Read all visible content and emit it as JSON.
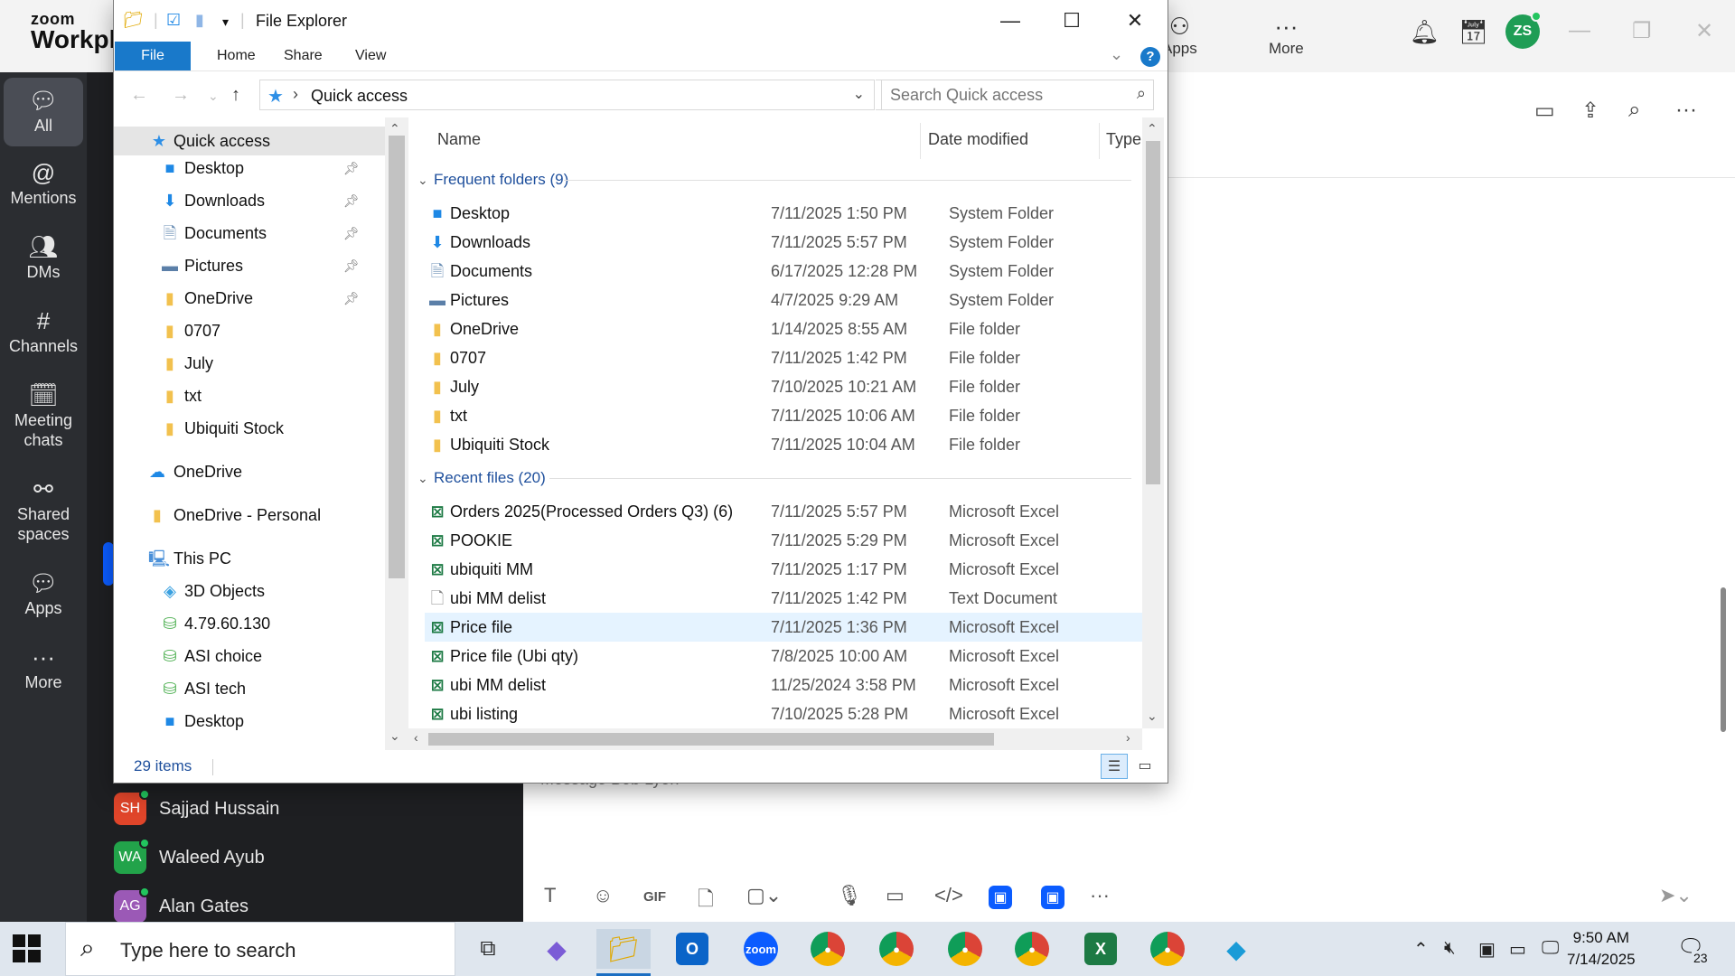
{
  "zoom": {
    "logo_line1": "zoom",
    "logo_line2": "Workplac",
    "top": {
      "apps_label": "Apps",
      "more_label": "More",
      "avatar": "ZS"
    },
    "nav": [
      {
        "label": "All",
        "icon": "chat-bubble-icon"
      },
      {
        "label": "Mentions",
        "icon": "at-icon"
      },
      {
        "label": "DMs",
        "icon": "people-icon"
      },
      {
        "label": "Channels",
        "icon": "hash-icon"
      },
      {
        "label_line1": "Meeting",
        "label_line2": "chats",
        "icon": "calendar-icon"
      },
      {
        "label_line1": "Shared",
        "label_line2": "spaces",
        "icon": "share-nodes-icon"
      },
      {
        "label": "Apps",
        "icon": "apps-icon"
      },
      {
        "label": "More",
        "icon": "more-dots-icon"
      }
    ],
    "chats": [
      {
        "initials": "SH",
        "name": "Sajjad Hussain",
        "color": "#e0452a"
      },
      {
        "initials": "WA",
        "name": "Waleed Ayub",
        "color": "#22a34a"
      },
      {
        "initials": "AG",
        "name": "Alan Gates",
        "color": "#9b59b6"
      }
    ],
    "message_placeholder": "Message Bob Lyon"
  },
  "explorer": {
    "title": "File Explorer",
    "ribbon_tabs": [
      "File",
      "Home",
      "Share",
      "View"
    ],
    "address_path": "Quick access",
    "search_placeholder": "Search Quick access",
    "nav_items": [
      {
        "label": "Quick access",
        "icon": "star-icon",
        "selected": true
      },
      {
        "label": "Desktop",
        "icon": "desktop-icon",
        "pinned": true
      },
      {
        "label": "Downloads",
        "icon": "download-icon",
        "pinned": true
      },
      {
        "label": "Documents",
        "icon": "documents-icon",
        "pinned": true
      },
      {
        "label": "Pictures",
        "icon": "pictures-icon",
        "pinned": true
      },
      {
        "label": "OneDrive",
        "icon": "folder-onedrive-icon",
        "pinned": true
      },
      {
        "label": "0707",
        "icon": "folder-icon"
      },
      {
        "label": "July",
        "icon": "folder-icon"
      },
      {
        "label": "txt",
        "icon": "folder-icon"
      },
      {
        "label": "Ubiquiti Stock",
        "icon": "folder-icon"
      },
      {
        "label": "OneDrive",
        "icon": "cloud-icon"
      },
      {
        "label": "OneDrive - Personal",
        "icon": "folder-icon"
      },
      {
        "label": "This PC",
        "icon": "computer-icon"
      },
      {
        "label": "3D Objects",
        "icon": "cube-icon"
      },
      {
        "label": "4.79.60.130",
        "icon": "network-drive-icon"
      },
      {
        "label": "ASI choice",
        "icon": "network-drive-icon"
      },
      {
        "label": "ASI tech",
        "icon": "network-drive-icon"
      },
      {
        "label": "Desktop",
        "icon": "desktop-icon"
      }
    ],
    "columns": {
      "name": "Name",
      "date": "Date modified",
      "type": "Type"
    },
    "frequent_label": "Frequent folders (9)",
    "recent_label": "Recent files (20)",
    "frequent": [
      {
        "name": "Desktop",
        "date": "7/11/2025 1:50 PM",
        "type": "System Folder",
        "icon": "desktop-icon"
      },
      {
        "name": "Downloads",
        "date": "7/11/2025 5:57 PM",
        "type": "System Folder",
        "icon": "download-icon"
      },
      {
        "name": "Documents",
        "date": "6/17/2025 12:28 PM",
        "type": "System Folder",
        "icon": "documents-icon"
      },
      {
        "name": "Pictures",
        "date": "4/7/2025 9:29 AM",
        "type": "System Folder",
        "icon": "pictures-icon"
      },
      {
        "name": "OneDrive",
        "date": "1/14/2025 8:55 AM",
        "type": "File folder",
        "icon": "folder-onedrive-icon"
      },
      {
        "name": "0707",
        "date": "7/11/2025 1:42 PM",
        "type": "File folder",
        "icon": "folder-icon"
      },
      {
        "name": "July",
        "date": "7/10/2025 10:21 AM",
        "type": "File folder",
        "icon": "folder-icon"
      },
      {
        "name": "txt",
        "date": "7/11/2025 10:06 AM",
        "type": "File folder",
        "icon": "folder-icon"
      },
      {
        "name": "Ubiquiti Stock",
        "date": "7/11/2025 10:04 AM",
        "type": "File folder",
        "icon": "folder-icon"
      }
    ],
    "recent": [
      {
        "name": "Orders 2025(Processed Orders Q3) (6)",
        "date": "7/11/2025 5:57 PM",
        "type": "Microsoft Excel",
        "icon": "excel-file-icon"
      },
      {
        "name": "POOKIE",
        "date": "7/11/2025 5:29 PM",
        "type": "Microsoft Excel",
        "icon": "excel-file-icon"
      },
      {
        "name": "ubiquiti MM",
        "date": "7/11/2025 1:17 PM",
        "type": "Microsoft Excel",
        "icon": "excel-file-icon"
      },
      {
        "name": "ubi MM delist",
        "date": "7/11/2025 1:42 PM",
        "type": "Text Document",
        "icon": "text-file-icon"
      },
      {
        "name": "Price file",
        "date": "7/11/2025 1:36 PM",
        "type": "Microsoft Excel",
        "icon": "excel-file-icon",
        "selected": true
      },
      {
        "name": "Price file (Ubi qty)",
        "date": "7/8/2025 10:00 AM",
        "type": "Microsoft Excel",
        "icon": "excel-file-icon"
      },
      {
        "name": "ubi MM delist",
        "date": "11/25/2024 3:58 PM",
        "type": "Microsoft Excel",
        "icon": "excel-file-icon"
      },
      {
        "name": "ubi listing",
        "date": "7/10/2025 5:28 PM",
        "type": "Microsoft Excel",
        "icon": "excel-file-icon"
      }
    ],
    "status_items": "29 items"
  },
  "taskbar": {
    "search_placeholder": "Type here to search",
    "time": "9:50 AM",
    "date": "7/14/2025",
    "notification_count": "23"
  }
}
